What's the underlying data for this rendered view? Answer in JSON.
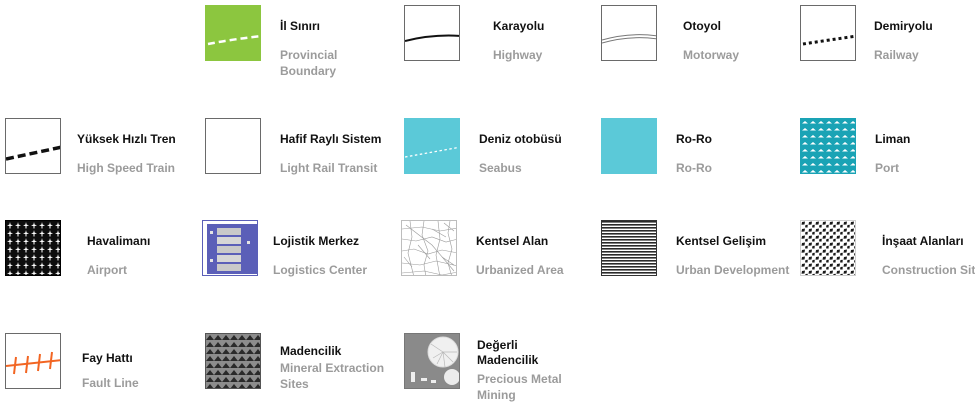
{
  "legend": {
    "items": [
      {
        "title": "İl Sınırı",
        "subtitle": "Provincial Boundary",
        "icon": "provincial-boundary-swatch"
      },
      {
        "title": "Karayolu",
        "subtitle": "Highway",
        "icon": "highway-swatch"
      },
      {
        "title": "Otoyol",
        "subtitle": "Motorway",
        "icon": "motorway-swatch"
      },
      {
        "title": "Demiryolu",
        "subtitle": "Railway",
        "icon": "railway-swatch"
      },
      {
        "title": "Yüksek Hızlı Tren",
        "subtitle": "High Speed Train",
        "icon": "high-speed-train-swatch"
      },
      {
        "title": "Hafif Raylı Sistem",
        "subtitle": "Light Rail Transit",
        "icon": "light-rail-swatch"
      },
      {
        "title": "Deniz otobüsü",
        "subtitle": "Seabus",
        "icon": "seabus-swatch"
      },
      {
        "title": "Ro-Ro",
        "subtitle": "Ro-Ro",
        "icon": "ro-ro-swatch"
      },
      {
        "title": "Liman",
        "subtitle": "Port",
        "icon": "port-swatch"
      },
      {
        "title": "Havalimanı",
        "subtitle": "Airport",
        "icon": "airport-swatch"
      },
      {
        "title": "Lojistik Merkez",
        "subtitle": "Logistics Center",
        "icon": "logistics-center-swatch"
      },
      {
        "title": "Kentsel Alan",
        "subtitle": "Urbanized Area",
        "icon": "urbanized-area-swatch"
      },
      {
        "title": "Kentsel Gelişim",
        "subtitle": "Urban Development",
        "icon": "urban-development-swatch"
      },
      {
        "title": "İnşaat Alanları",
        "subtitle": "Construction Sites",
        "icon": "construction-sites-swatch"
      },
      {
        "title": "Fay Hattı",
        "subtitle": "Fault Line",
        "icon": "fault-line-swatch"
      },
      {
        "title": "Madencilik",
        "subtitle": "Mineral Extraction Sites",
        "icon": "mineral-extraction-swatch"
      },
      {
        "title": "Değerli Madencilik",
        "subtitle": "Precious Metal Mining",
        "icon": "precious-metal-mining-swatch"
      }
    ]
  },
  "colors": {
    "boundary_green": "#8cc63f",
    "sea_cyan": "#5bc9d8",
    "port_teal": "#1aa3b5",
    "logistics_purple": "#5b5fb8",
    "fault_orange": "#f26522",
    "title_text": "#111111",
    "subtitle_text": "#9b9b9b"
  }
}
